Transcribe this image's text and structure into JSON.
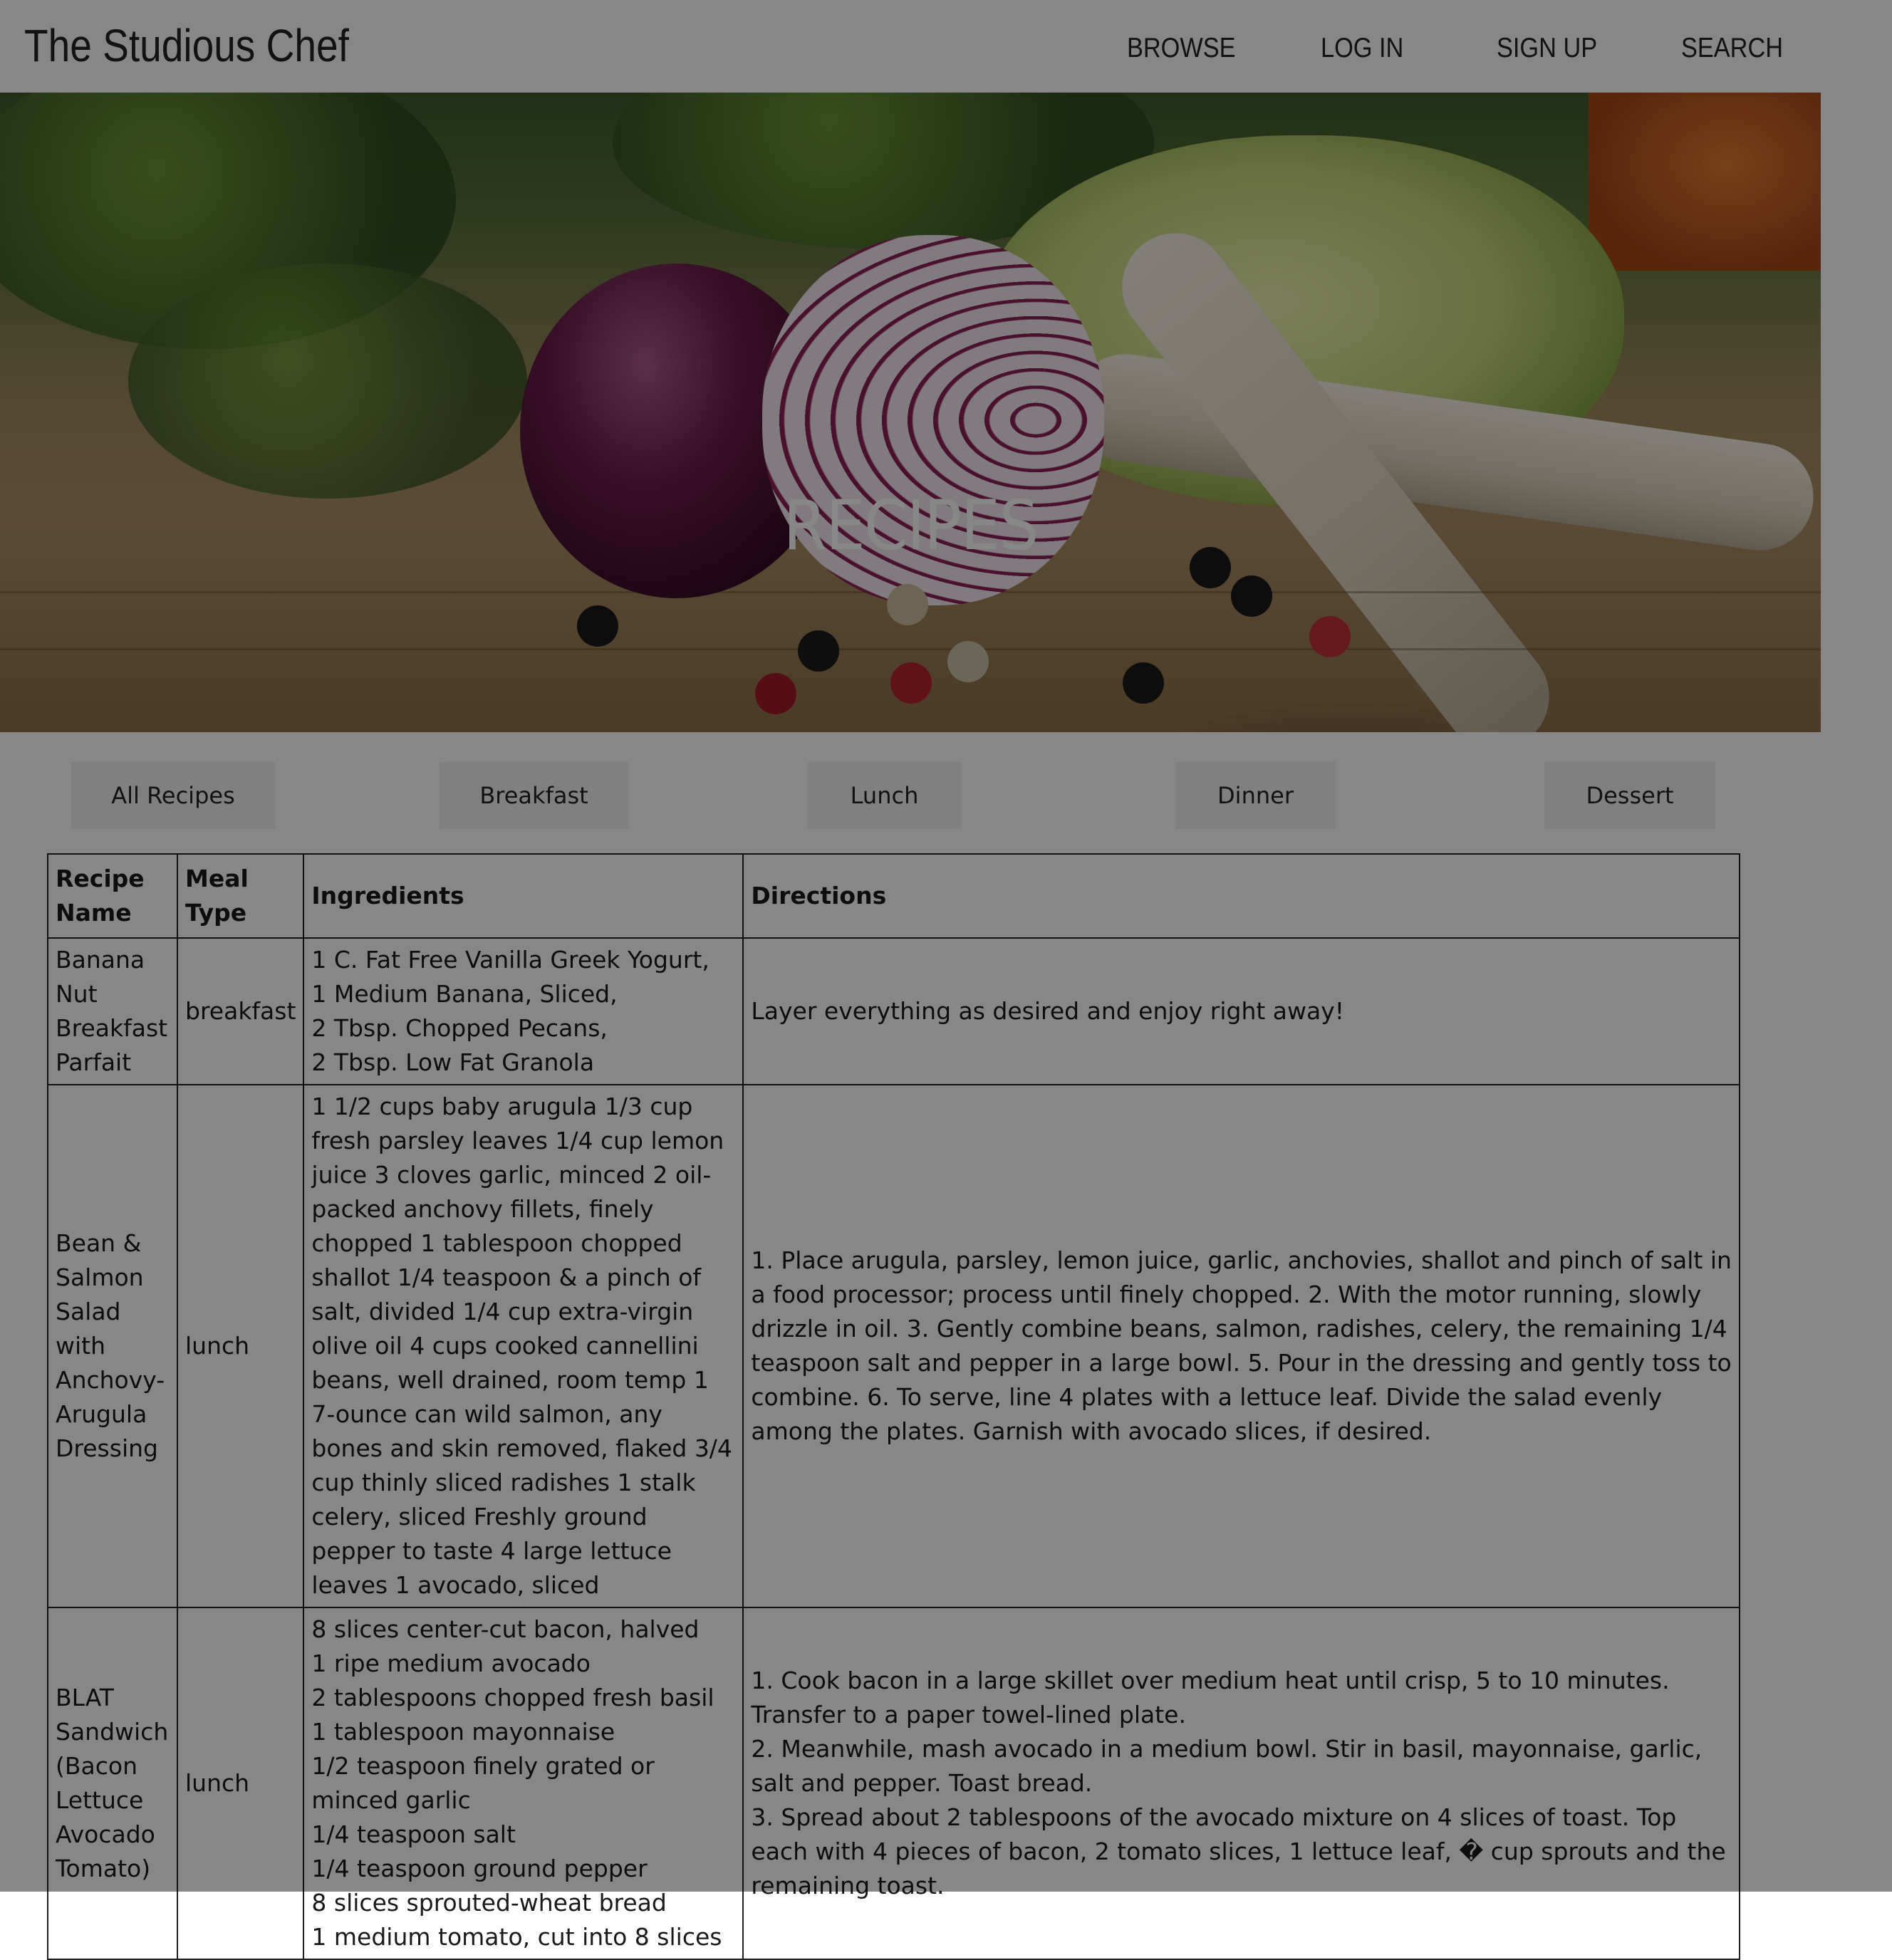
{
  "header": {
    "brand": "The Studious Chef",
    "nav": {
      "browse": "BROWSE",
      "login": "LOG IN",
      "signup": "SIGN UP",
      "search": "SEARCH"
    }
  },
  "hero": {
    "title": "RECIPES",
    "image": "vegetables-and-red-onion-photo"
  },
  "categories": {
    "all": "All Recipes",
    "breakfast": "Breakfast",
    "lunch": "Lunch",
    "dinner": "Dinner",
    "dessert": "Dessert"
  },
  "table": {
    "headers": {
      "name": "Recipe\nName",
      "meal": "Meal\nType",
      "ingredients": "Ingredients",
      "directions": "Directions"
    },
    "rows": [
      {
        "name": "Banana Nut Breakfast Parfait",
        "meal": "breakfast",
        "ingredients": "1 C. Fat Free Vanilla Greek Yogurt,\n1 Medium Banana, Sliced,\n2 Tbsp. Chopped Pecans,\n2 Tbsp. Low Fat Granola",
        "directions": "Layer everything as desired and enjoy right away!"
      },
      {
        "name": "Bean & Salmon Salad with Anchovy-Arugula Dressing",
        "meal": "lunch",
        "ingredients": "1 1/2 cups baby arugula 1/3 cup fresh parsley leaves 1/4 cup lemon juice 3 cloves garlic, minced 2 oil-packed anchovy fillets, finely chopped 1 tablespoon chopped shallot 1/4 teaspoon & a pinch of salt, divided 1/4 cup extra-virgin olive oil 4 cups cooked cannellini beans, well drained, room temp 1 7-ounce can wild salmon, any bones and skin removed, flaked 3/4 cup thinly sliced radishes 1 stalk celery, sliced Freshly ground pepper to taste 4 large lettuce leaves 1 avocado, sliced",
        "directions": "1. Place arugula, parsley, lemon juice, garlic, anchovies, shallot and pinch of salt in a food processor; process until finely chopped. 2. With the motor running, slowly drizzle in oil. 3. Gently combine beans, salmon, radishes, celery, the remaining 1/4 teaspoon salt and pepper in a large bowl. 5. Pour in the dressing and gently toss to combine. 6. To serve, line 4 plates with a lettuce leaf. Divide the salad evenly among the plates. Garnish with avocado slices, if desired."
      },
      {
        "name": "BLAT Sandwich (Bacon Lettuce Avocado Tomato)",
        "meal": "lunch",
        "ingredients": "8 slices center-cut bacon, halved\n1 ripe medium avocado\n2 tablespoons chopped fresh basil\n1 tablespoon mayonnaise\n1/2 teaspoon finely grated or minced garlic\n1/4 teaspoon salt\n1/4 teaspoon ground pepper\n8 slices sprouted-wheat bread\n1 medium tomato, cut into 8 slices",
        "directions": "1. Cook bacon in a large skillet over medium heat until crisp, 5 to 10 minutes. Transfer to a paper towel-lined plate.\n2. Meanwhile, mash avocado in a medium bowl. Stir in basil, mayonnaise, garlic, salt and pepper. Toast bread.\n3. Spread about 2 tablespoons of the avocado mixture on 4 slices of toast. Top each with 4 pieces of bacon, 2 tomato slices, 1 lettuce leaf, � cup sprouts and the remaining toast."
      }
    ]
  }
}
